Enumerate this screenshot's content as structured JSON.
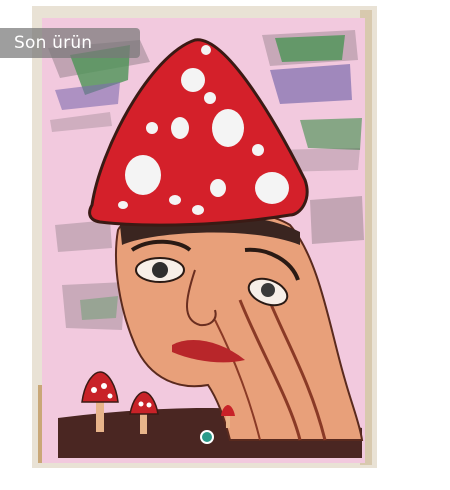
{
  "product_photo": {
    "description_icon": "mushroom-head-painting",
    "colors": {
      "canvas_pink": "#f2c9de",
      "cap_red": "#d4202a",
      "ground_brown": "#4a2622",
      "skin": "#e8a07a"
    }
  },
  "badge": {
    "label": "Son ürün"
  }
}
